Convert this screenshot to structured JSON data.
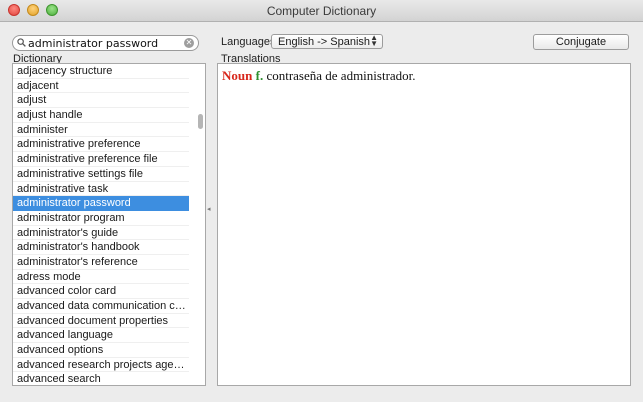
{
  "window": {
    "title": "Computer Dictionary"
  },
  "search": {
    "value": "administrator password",
    "icon": "magnifier",
    "clear_icon": "x"
  },
  "labels": {
    "dictionary": "Dictionary",
    "languages": "Languages:",
    "translations": "Translations"
  },
  "language_select": {
    "value": "English -> Spanish"
  },
  "conjugate_button": {
    "label": "Conjugate"
  },
  "dictionary": {
    "selected_index": 9,
    "items": [
      "adjacency structure",
      "adjacent",
      "adjust",
      "adjust handle",
      "administer",
      "administrative preference",
      "administrative preference file",
      "administrative settings file",
      "administrative task",
      "administrator password",
      "administrator program",
      "administrator's guide",
      "administrator's handbook",
      "administrator's reference",
      "adress mode",
      "advanced color card",
      "advanced data communication control...",
      "advanced document properties",
      "advanced language",
      "advanced options",
      "advanced research projects agency network",
      "advanced search"
    ]
  },
  "translation": {
    "part_of_speech": "Noun",
    "gender": "f.",
    "text": "contraseña de administrador.",
    "colors": {
      "part_of_speech": "#d8271c",
      "gender": "#2e8f2e"
    }
  },
  "colors": {
    "selection": "#3d8ee0"
  }
}
